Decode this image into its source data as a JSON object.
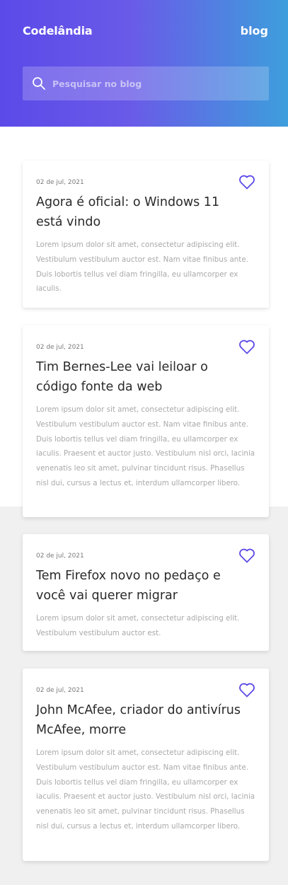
{
  "header": {
    "brand": "Codelândia",
    "nav_link": "blog",
    "search_placeholder": "Pesquisar no blog"
  },
  "colors": {
    "gradient_start": "#5b4ae8",
    "gradient_end": "#3d9edc",
    "accent": "#5b4ae8"
  },
  "posts": [
    {
      "date": "02 de jul, 2021",
      "title": "Agora é oficial: o Windows 11 está vindo",
      "excerpt": "Lorem ipsum dolor sit amet, consectetur adipiscing elit. Vestibulum vestibulum auctor est. Nam vitae finibus ante. Duis lobortis tellus vel diam fringilla, eu ullamcorper ex iaculis."
    },
    {
      "date": "02 de jul, 2021",
      "title": "Tim Bernes-Lee vai leiloar o código fonte da web",
      "excerpt": "Lorem ipsum dolor sit amet, consectetur adipiscing elit. Vestibulum vestibulum auctor est. Nam vitae finibus ante. Duis lobortis tellus vel diam fringilla, eu ullamcorper ex iaculis. Praesent et auctor justo. Vestibulum nisl orci, lacinia venenatis leo sit amet, pulvinar tincidunt risus. Phasellus nisl dui, cursus a lectus et, interdum ullamcorper libero."
    },
    {
      "date": "02 de jul, 2021",
      "title": "Tem Firefox novo no pedaço e você vai querer migrar",
      "excerpt": "Lorem ipsum dolor sit amet, consectetur adipiscing elit. Vestibulum vestibulum auctor est."
    },
    {
      "date": "02 de jul, 2021",
      "title": "John McAfee, criador do antivírus McAfee, morre",
      "excerpt": "Lorem ipsum dolor sit amet, consectetur adipiscing elit. Vestibulum vestibulum auctor est. Nam vitae finibus ante. Duis lobortis tellus vel diam fringilla, eu ullamcorper ex iaculis. Praesent et auctor justo. Vestibulum nisl orci, lacinia venenatis leo sit amet, pulvinar tincidunt risus. Phasellus nisl dui, cursus a lectus et, interdum ullamcorper libero."
    }
  ]
}
